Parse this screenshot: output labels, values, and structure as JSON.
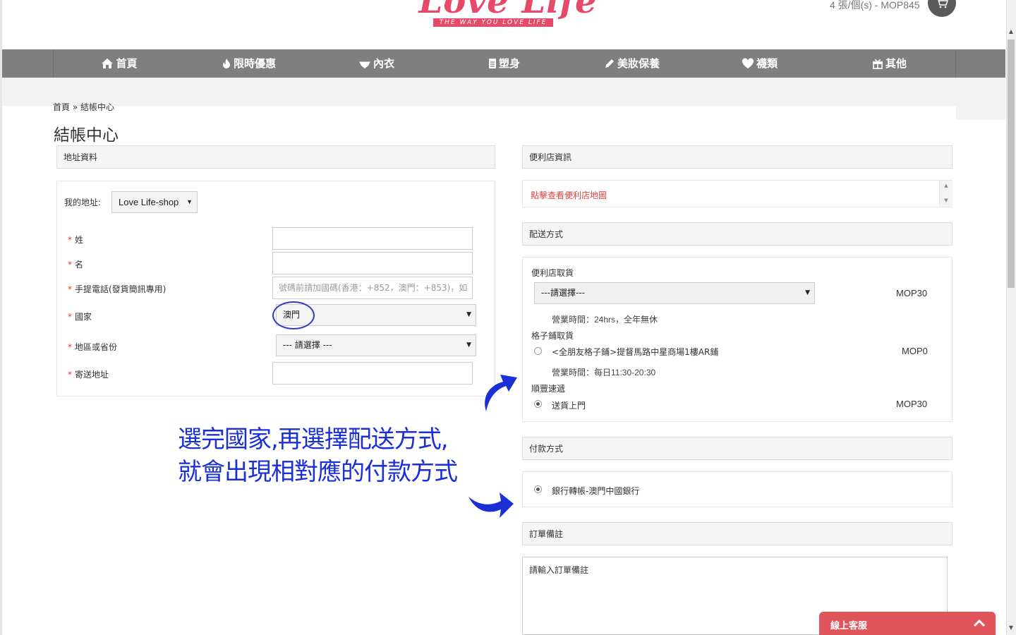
{
  "header": {
    "logo_text": "Love Life",
    "logo_tagline": "THE WAY YOU LOVE LIFE",
    "cart_summary": "4 張/個(s) - MOP845"
  },
  "nav": {
    "items": [
      {
        "label": "首頁",
        "icon": "home-icon"
      },
      {
        "label": "限時優惠",
        "icon": "fire-icon"
      },
      {
        "label": "內衣",
        "icon": "bra-icon"
      },
      {
        "label": "塑身",
        "icon": "shaping-icon"
      },
      {
        "label": "美妝保養",
        "icon": "pencil-icon"
      },
      {
        "label": "襪類",
        "icon": "heart-icon"
      },
      {
        "label": "其他",
        "icon": "gift-icon"
      }
    ]
  },
  "breadcrumb": {
    "home": "首頁",
    "sep": "»",
    "current": "結帳中心"
  },
  "page_title": "結帳中心",
  "address": {
    "heading": "地址資料",
    "my_address_label": "我的地址:",
    "my_address_value": "Love Life-shop",
    "fields": {
      "last_name": "姓",
      "first_name": "名",
      "mobile": "手提電話(發貨簡訊專用)",
      "mobile_placeholder": "號碼前請加國碼(香港：+852，澳門：+853)，如",
      "country": "國家",
      "country_value": "澳門",
      "region": "地區或省份",
      "region_value": "--- 請選擇 ---",
      "address": "寄送地址"
    }
  },
  "store_info": {
    "heading": "便利店資訊",
    "map_link": "點擊查看便利店地圖"
  },
  "shipping": {
    "heading": "配送方式",
    "store_pickup": {
      "title": "便利店取貨",
      "select_value": "---請選擇---",
      "price": "MOP30",
      "hours": "營業時間：24hrs，全年無休"
    },
    "locker": {
      "title": "格子鋪取貨",
      "option": "<全朋友格子鋪>提督馬路中星商場1樓AR鋪",
      "price": "MOP0",
      "hours": "營業時間：每日11:30-20:30"
    },
    "sf": {
      "title": "順豐速遞",
      "option": "送貨上門",
      "price": "MOP30"
    }
  },
  "payment": {
    "heading": "付款方式",
    "option": "銀行轉帳-澳門中國銀行"
  },
  "notes": {
    "heading": "訂單備註",
    "placeholder": "請輸入訂單備註"
  },
  "annotation": {
    "line1": "選完國家,再選擇配送方式,",
    "line2": "就會出現相對應的付款方式"
  },
  "chat": {
    "label": "線上客服"
  },
  "colors": {
    "brand": "#e64a6b",
    "nav": "#7f7f7f",
    "annotation": "#1a2fd6",
    "chat": "#e2545b",
    "link": "#e0413b"
  }
}
